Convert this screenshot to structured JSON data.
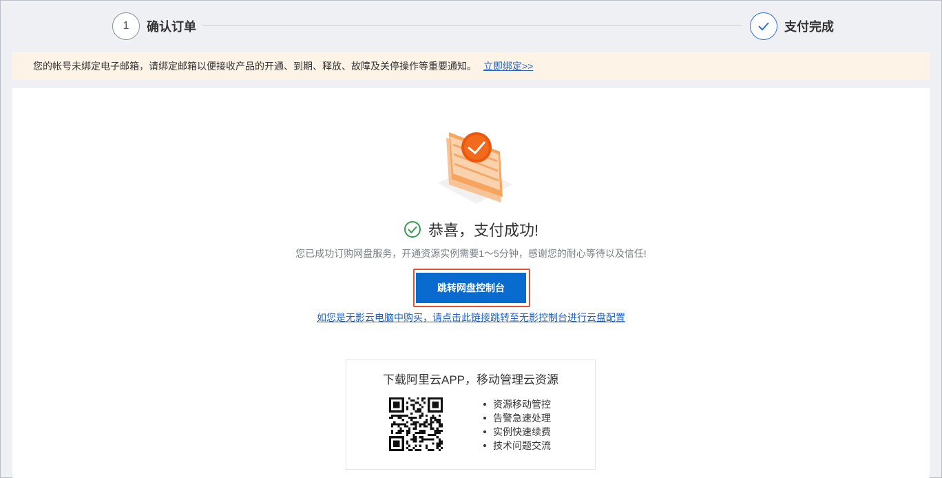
{
  "stepper": {
    "step1": {
      "number": "1",
      "label": "确认订单"
    },
    "step2": {
      "label": "支付完成",
      "icon": "check-icon"
    }
  },
  "notice": {
    "text": "您的帐号未绑定电子邮箱，请绑定邮箱以便接收产品的开通、到期、释放、故障及关停操作等重要通知。",
    "link": "立即绑定>>"
  },
  "result": {
    "title": "恭喜，支付成功!",
    "description": "您已成功订购网盘服务，开通资源实例需要1～5分钟，感谢您的耐心等待以及信任!",
    "primary_button": "跳转网盘控制台",
    "alt_link": "如您是无影云电脑中购买，请点击此链接跳转至无影控制台进行云盘配置"
  },
  "app_promo": {
    "title": "下载阿里云APP，移动管理云资源",
    "features": [
      "资源移动管控",
      "告警急速处理",
      "实例快速续费",
      "技术问题交流"
    ]
  },
  "colors": {
    "primary": "#0a6bcf",
    "highlight_border": "#e84f2f",
    "success": "#2f9e4f",
    "link": "#1f62c2",
    "notice_bg": "#fdf3e6"
  }
}
